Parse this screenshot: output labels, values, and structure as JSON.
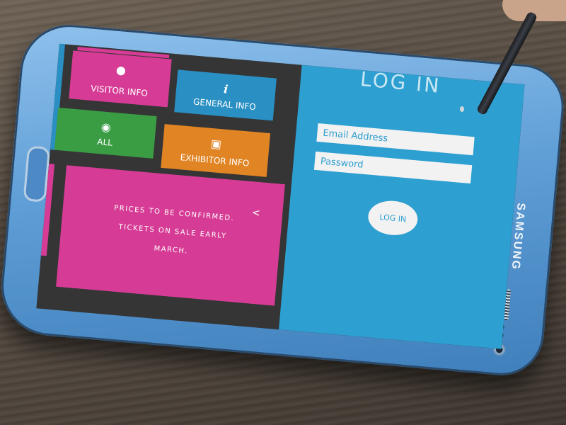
{
  "tiles": {
    "visitor": {
      "label": "VISITOR INFO",
      "icon": "person-icon"
    },
    "general": {
      "label": "GENERAL INFO",
      "icon": "info-icon"
    },
    "all": {
      "label": "ALL",
      "icon": "eye-icon"
    },
    "exhibitor": {
      "label": "EXHIBITOR INFO",
      "icon": "badge-icon"
    }
  },
  "promo": {
    "text": "PRICES TO BE CONFIRMED. TICKETS ON SALE EARLY MARCH.",
    "chevron": "<"
  },
  "login": {
    "title": "LOG IN",
    "email_placeholder": "Email Address",
    "password_placeholder": "Password",
    "button_label": "LOG IN"
  },
  "device": {
    "brand": "SAMSUNG"
  },
  "colors": {
    "pink": "#d63c95",
    "blue": "#2a8fc3",
    "green": "#3a9d44",
    "orange": "#e08424",
    "login_bg": "#2d9fd1"
  }
}
